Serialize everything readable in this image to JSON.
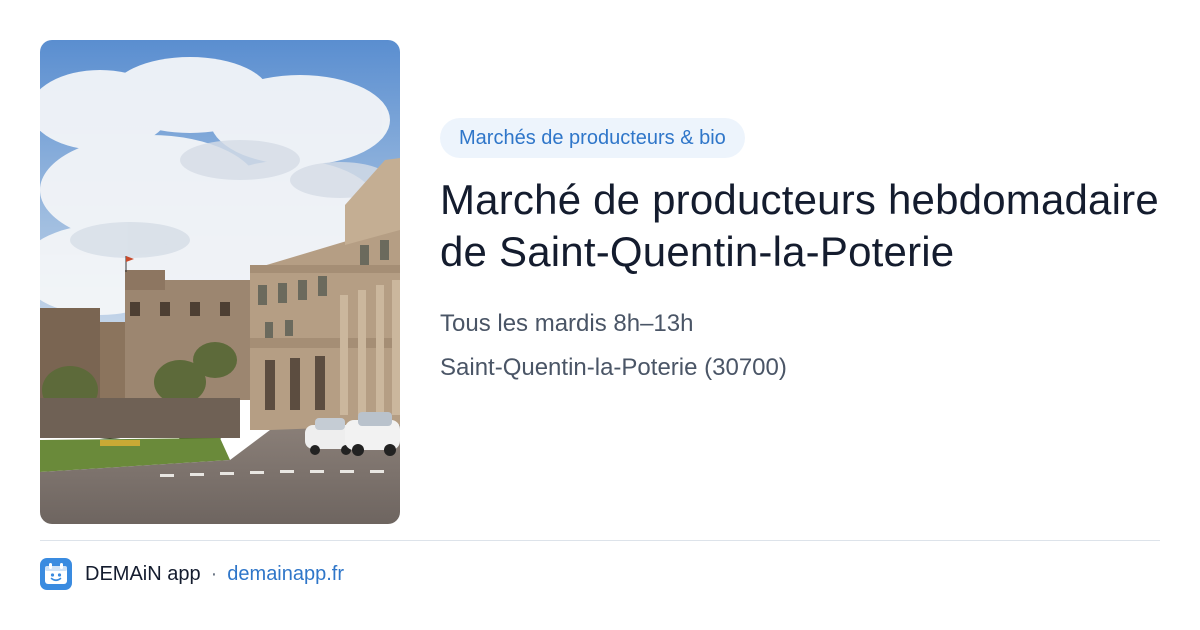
{
  "card": {
    "category": "Marchés de producteurs & bio",
    "title": "Marché de producteurs hebdomadaire de Saint-Quentin-la-Poterie",
    "schedule": "Tous les mardis 8h–13h",
    "location": "Saint-Quentin-la-Poterie (30700)"
  },
  "footer": {
    "app_name": "DEMAiN app",
    "separator": "·",
    "domain": "demainapp.fr",
    "icon": "demain-app-logo-icon"
  },
  "photo": {
    "subject": "town-square-building-photo"
  },
  "colors": {
    "accent": "#2f76c9",
    "pill_bg": "#edf4fc",
    "title": "#141c2e",
    "meta": "#4a5566",
    "app_icon_bg": "#3a8be0"
  }
}
